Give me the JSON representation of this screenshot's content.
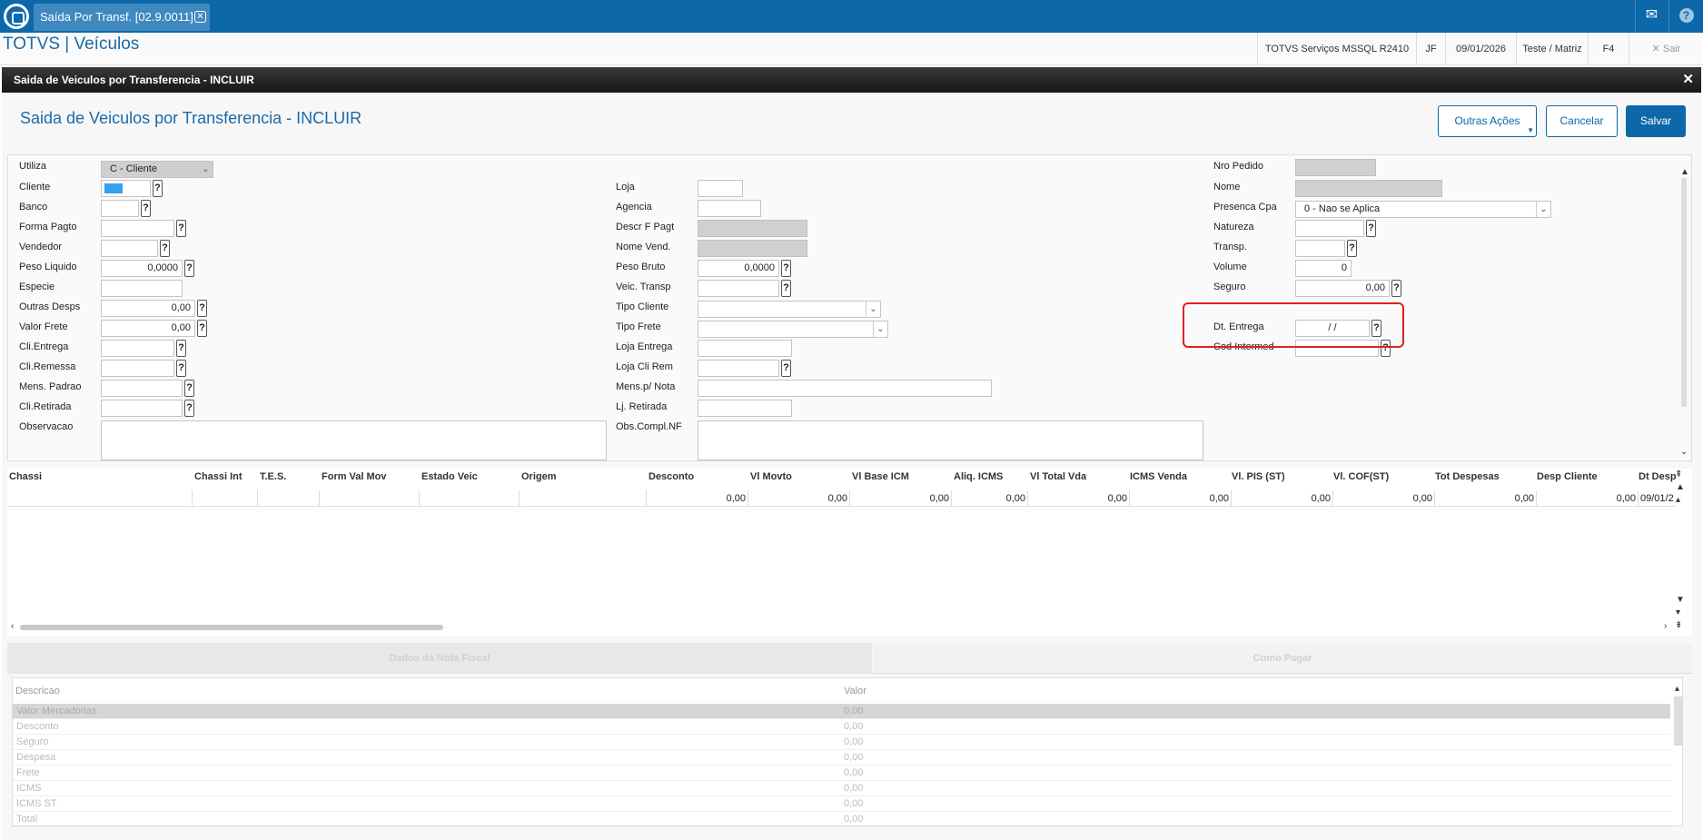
{
  "topbar": {
    "tab_title": "Saída Por Transf. [02.9.0011]",
    "tab_close": "✕"
  },
  "subbar": {
    "app_title": "TOTVS | Veículos",
    "environment": "TOTVS Serviços MSSQL R2410",
    "user": "JF",
    "date": "09/01/2026",
    "company": "Teste / Matriz",
    "shortcut": "F4",
    "exit": "Sair"
  },
  "modal": {
    "header": "Saida de Veiculos por Transferencia - INCLUIR",
    "title": "Saida de Veiculos por Transferencia - INCLUIR"
  },
  "actions": {
    "more": "Outras Ações",
    "cancel": "Cancelar",
    "save": "Salvar"
  },
  "form": {
    "col1": {
      "utiliza": "Utiliza",
      "utiliza_value": "C - Cliente",
      "cliente": "Cliente",
      "banco": "Banco",
      "forma_pagto": "Forma Pagto",
      "vendedor": "Vendedor",
      "peso_liquido": "Peso Liquido",
      "peso_liquido_value": "0,0000",
      "especie": "Especie",
      "outras_desps": "Outras Desps",
      "outras_desps_value": "0,00",
      "valor_frete": "Valor Frete",
      "valor_frete_value": "0,00",
      "cli_entrega": "Cli.Entrega",
      "cli_remessa": "Cli.Remessa",
      "mens_padrao": "Mens. Padrao",
      "cli_retirada": "Cli.Retirada",
      "observacao": "Observacao"
    },
    "col2": {
      "loja": "Loja",
      "agencia": "Agencia",
      "descr_f_pagt": "Descr F Pagt",
      "nome_vend": "Nome Vend.",
      "peso_bruto": "Peso Bruto",
      "peso_bruto_value": "0,0000",
      "veic_transp": "Veic. Transp",
      "tipo_cliente": "Tipo Cliente",
      "tipo_frete": "Tipo Frete",
      "loja_entrega": "Loja Entrega",
      "loja_cli_rem": "Loja Cli Rem",
      "mens_nota": "Mens.p/ Nota",
      "lj_retirada": "Lj. Retirada",
      "obs_compl": "Obs.Compl.NF"
    },
    "col3": {
      "nro_pedido": "Nro Pedido",
      "nome": "Nome",
      "presenca_cpa": "Presenca Cpa",
      "presenca_cpa_value": "0 - Nao se Aplica",
      "natureza": "Natureza",
      "transp": "Transp.",
      "volume": "Volume",
      "volume_value": "0",
      "seguro": "Seguro",
      "seguro_value": "0,00",
      "dt_entrega": "Dt. Entrega",
      "dt_entrega_value": "/  /",
      "cod_intermed": "Cod Intermed"
    },
    "help_glyph": "?"
  },
  "grid": {
    "headers": [
      "Chassi",
      "Chassi Int",
      "T.E.S.",
      "Form Val Mov",
      "Estado Veic",
      "Origem",
      "Desconto",
      "Vl Movto",
      "Vl Base ICM",
      "Aliq. ICMS",
      "Vl Total Vda",
      "ICMS Venda",
      "Vl. PIS (ST)",
      "Vl. COF(ST)",
      "Tot Despesas",
      "Desp Cliente",
      "Dt Desp"
    ],
    "row": [
      "0,00",
      "0,00",
      "0,00",
      "0,00",
      "0,00",
      "0,00",
      "0,00",
      "0,00",
      "0,00",
      "0,00",
      "09/01/2"
    ]
  },
  "tabs": [
    "Dados da Nota Fiscal",
    "Como Pagar"
  ],
  "totals": {
    "header_desc": "Descricao",
    "header_value": "Valor",
    "rows": [
      {
        "desc": "Valor Mercadorias",
        "value": "0,00"
      },
      {
        "desc": "Desconto",
        "value": "0,00"
      },
      {
        "desc": "Seguro",
        "value": "0,00"
      },
      {
        "desc": "Despesa",
        "value": "0,00"
      },
      {
        "desc": "Frete",
        "value": "0,00"
      },
      {
        "desc": "ICMS",
        "value": "0,00"
      },
      {
        "desc": "ICMS ST",
        "value": "0,00"
      },
      {
        "desc": "Total",
        "value": "0,00"
      }
    ]
  },
  "colors": {
    "brand": "#0c68a8",
    "highlight": "#e02020"
  }
}
